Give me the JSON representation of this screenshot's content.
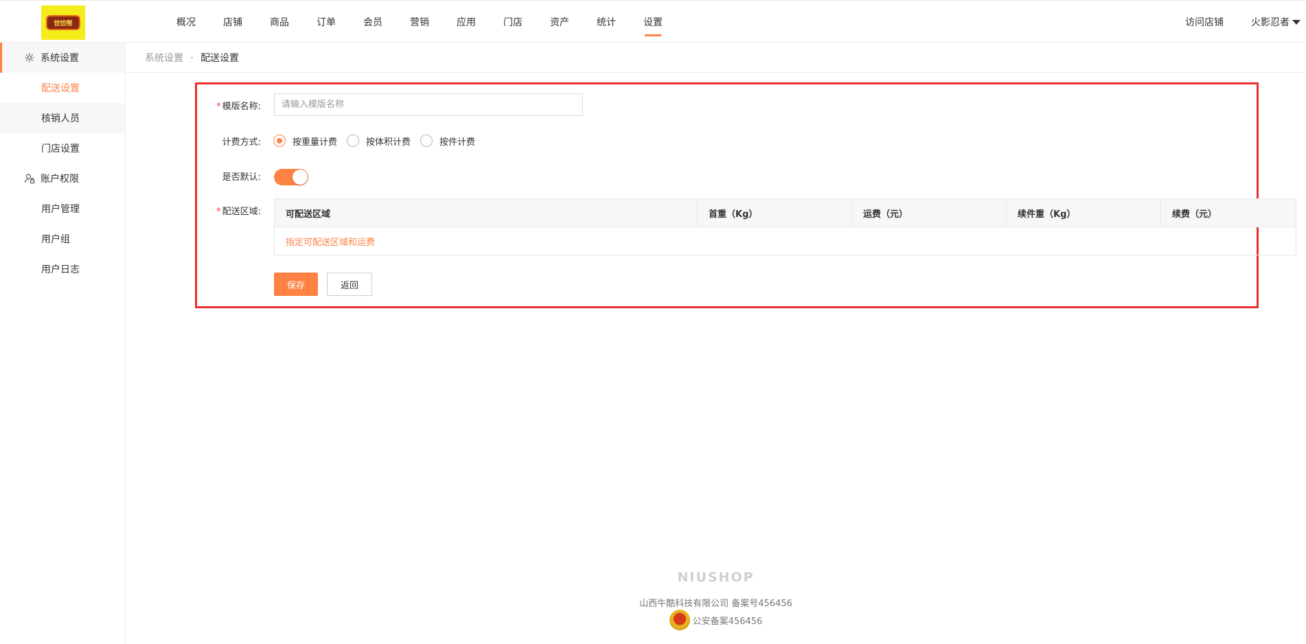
{
  "header": {
    "logo_text": "饺饺帮",
    "nav": [
      "概况",
      "店铺",
      "商品",
      "订单",
      "会员",
      "营销",
      "应用",
      "门店",
      "资产",
      "统计",
      "设置"
    ],
    "active_nav": "设置",
    "visit_store": "访问店铺",
    "user_name": "火影忍者"
  },
  "sidebar": {
    "group1_label": "系统设置",
    "group1_items": [
      "配送设置",
      "核销人员",
      "门店设置"
    ],
    "group2_label": "账户权限",
    "group2_items": [
      "用户管理",
      "用户组",
      "用户日志"
    ]
  },
  "breadcrumb": {
    "parent": "系统设置",
    "separator": "-",
    "current": "配送设置"
  },
  "form": {
    "required_mark": "*",
    "template_name_label": "模版名称:",
    "template_name_placeholder": "请输入模版名称",
    "template_name_value": "",
    "billing_label": "计费方式:",
    "billing_options": [
      "按重量计费",
      "按体积计费",
      "按件计费"
    ],
    "billing_selected": "按重量计费",
    "default_label": "是否默认:",
    "default_on": true,
    "area_label": "配送区域:",
    "area_columns": [
      "可配送区域",
      "首重（Kg）",
      "运费（元）",
      "续件重（Kg）",
      "续费（元）"
    ],
    "area_link": "指定可配送区域和运费",
    "save_label": "保存",
    "back_label": "返回"
  },
  "footer": {
    "brand": "NIUSHOP",
    "company": "山西牛酷科技有限公司  备案号456456",
    "police_record": "公安备案456456"
  },
  "colors": {
    "accent": "#ff8143",
    "highlight_border": "#ec2f2f"
  }
}
